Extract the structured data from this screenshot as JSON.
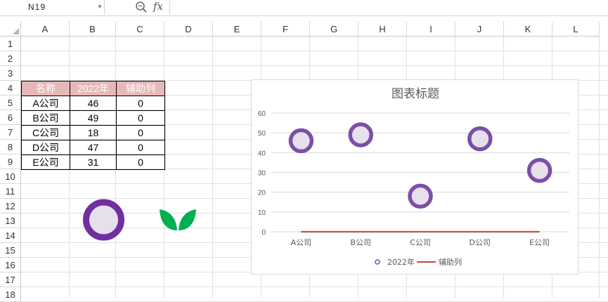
{
  "formula_bar": {
    "name_box": "N19",
    "fx_label": "fx"
  },
  "grid": {
    "columns": [
      "A",
      "B",
      "C",
      "D",
      "E",
      "F",
      "G",
      "H",
      "I",
      "J",
      "K",
      "L"
    ],
    "rows": [
      "1",
      "2",
      "3",
      "4",
      "5",
      "6",
      "7",
      "8",
      "9",
      "10",
      "11",
      "12",
      "13",
      "14",
      "15",
      "16",
      "17",
      "18"
    ]
  },
  "table": {
    "headers": [
      "名称",
      "2022年",
      "辅助列"
    ],
    "rows": [
      [
        "A公司",
        "46",
        "0"
      ],
      [
        "B公司",
        "49",
        "0"
      ],
      [
        "C公司",
        "18",
        "0"
      ],
      [
        "D公司",
        "47",
        "0"
      ],
      [
        "E公司",
        "31",
        "0"
      ]
    ],
    "header_color": "#e6b8b7"
  },
  "shapes": {
    "ring_icon": "ring-marker-icon",
    "leaf_icon": "leaf-icon",
    "ring_color": "#7030a0",
    "ring_fill": "#e6e0ec",
    "leaf_color": "#00b050"
  },
  "chart_data": {
    "type": "scatter",
    "title": "图表标题",
    "categories": [
      "A公司",
      "B公司",
      "C公司",
      "D公司",
      "E公司"
    ],
    "series": [
      {
        "name": "2022年",
        "type": "scatter",
        "values": [
          46,
          49,
          18,
          47,
          31
        ],
        "color": "#7b4fa6",
        "fill": "#e6e0ec"
      },
      {
        "name": "辅助列",
        "type": "line",
        "values": [
          0,
          0,
          0,
          0,
          0
        ],
        "color": "#c0504d"
      }
    ],
    "ylim": [
      0,
      60
    ],
    "yticks": [
      "0",
      "10",
      "20",
      "30",
      "40",
      "50",
      "60"
    ],
    "grid": true,
    "legend": "bottom"
  }
}
